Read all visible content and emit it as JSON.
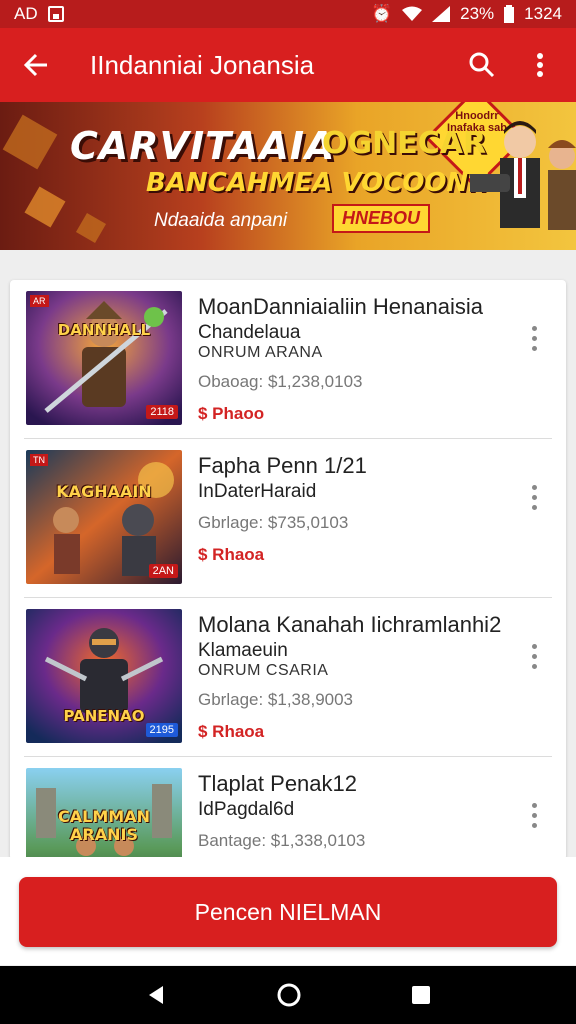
{
  "status_bar": {
    "left_text": "AD",
    "battery": "23%",
    "time": "1324"
  },
  "app_bar": {
    "title": "IIndanniai Jonansia"
  },
  "banner": {
    "title": "CARVITAAIA",
    "title2": "OGNECAR",
    "subtitle": "BANCAHMEA VOCOONI!",
    "tagline": "Ndaaida anpani",
    "badge": "HNEBOU",
    "sign_text": "Hnoodrr Inafaka sab",
    "colors": {
      "from": "#6b1c12",
      "to": "#f3c53e",
      "accent": "#ffd732"
    }
  },
  "games": [
    {
      "title": "MoanDanniaialiin Henanaisia",
      "subtitle": "Chandelaua",
      "subtitle2": "ONRUM ARANA",
      "stat": "Obaoag: $1,238,0103",
      "price": "$ Phaoo",
      "thumb_title": "DANNHALL",
      "thumb_badge": "2118",
      "thumb_corner": "AR",
      "thumb_icon": "warrior-art"
    },
    {
      "title": "Fapha Penn 1/21",
      "subtitle": "InDaterHaraid",
      "subtitle2": "",
      "stat": "Gbrlage: $735,0103",
      "price": "$ Rhaoa",
      "thumb_title": "KAGHAAIN",
      "thumb_badge": "2AN",
      "thumb_corner": "TN",
      "thumb_icon": "robot-art"
    },
    {
      "title": "Molana Kanahah Iichramlanhi2",
      "subtitle": "Klamaeuin",
      "subtitle2": "ONRUM CSARIA",
      "stat": "Gbrlage: $1,38,9003",
      "price": "$ Rhaoa",
      "thumb_title": "PANENAO",
      "thumb_badge": "2195",
      "thumb_corner": "",
      "thumb_icon": "ninja-art"
    },
    {
      "title": "Tlaplat Penak12",
      "subtitle": "IdPagdal6d",
      "subtitle2": "",
      "stat": "Bantage: $1,338,0103",
      "price": "",
      "thumb_title": "CALMMAN ARANIS",
      "thumb_badge": "",
      "thumb_corner": "",
      "thumb_icon": "castle-art"
    }
  ],
  "cta": {
    "label": "Pencen NIELMAN"
  },
  "colors": {
    "primary": "#d81f1f",
    "price": "#d32424"
  }
}
